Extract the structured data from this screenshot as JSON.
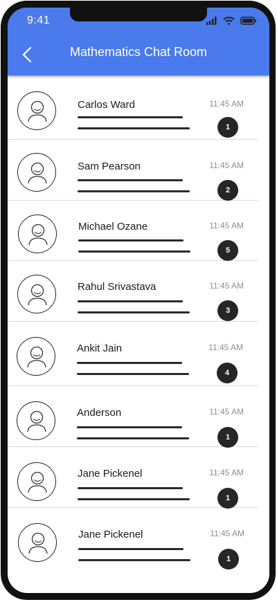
{
  "status": {
    "time": "9:41"
  },
  "header": {
    "title": "Mathematics Chat Room"
  },
  "icons": {
    "back": "chevron-left-icon",
    "avatar": "user-avatar-icon",
    "signal": "signal-icon",
    "wifi": "wifi-icon",
    "battery": "battery-icon"
  },
  "colors": {
    "header_bg": "#4a7aeb",
    "badge_bg": "#262626"
  },
  "chats": [
    {
      "name": "Carlos Ward",
      "time": "11:45 AM",
      "unread": "1"
    },
    {
      "name": "Sam Pearson",
      "time": "11:45 AM",
      "unread": "2"
    },
    {
      "name": "Michael Ozane",
      "time": "11:45 AM",
      "unread": "5"
    },
    {
      "name": "Rahul Srivastava",
      "time": "11:45 AM",
      "unread": "3"
    },
    {
      "name": "Ankit Jain",
      "time": "11:45 AM",
      "unread": "4"
    },
    {
      "name": "Anderson",
      "time": "11:45 AM",
      "unread": "1"
    },
    {
      "name": "Jane Pickenel",
      "time": "11:45 AM",
      "unread": "1"
    },
    {
      "name": "Jane Pickenel",
      "time": "11:45 AM",
      "unread": "1"
    }
  ]
}
